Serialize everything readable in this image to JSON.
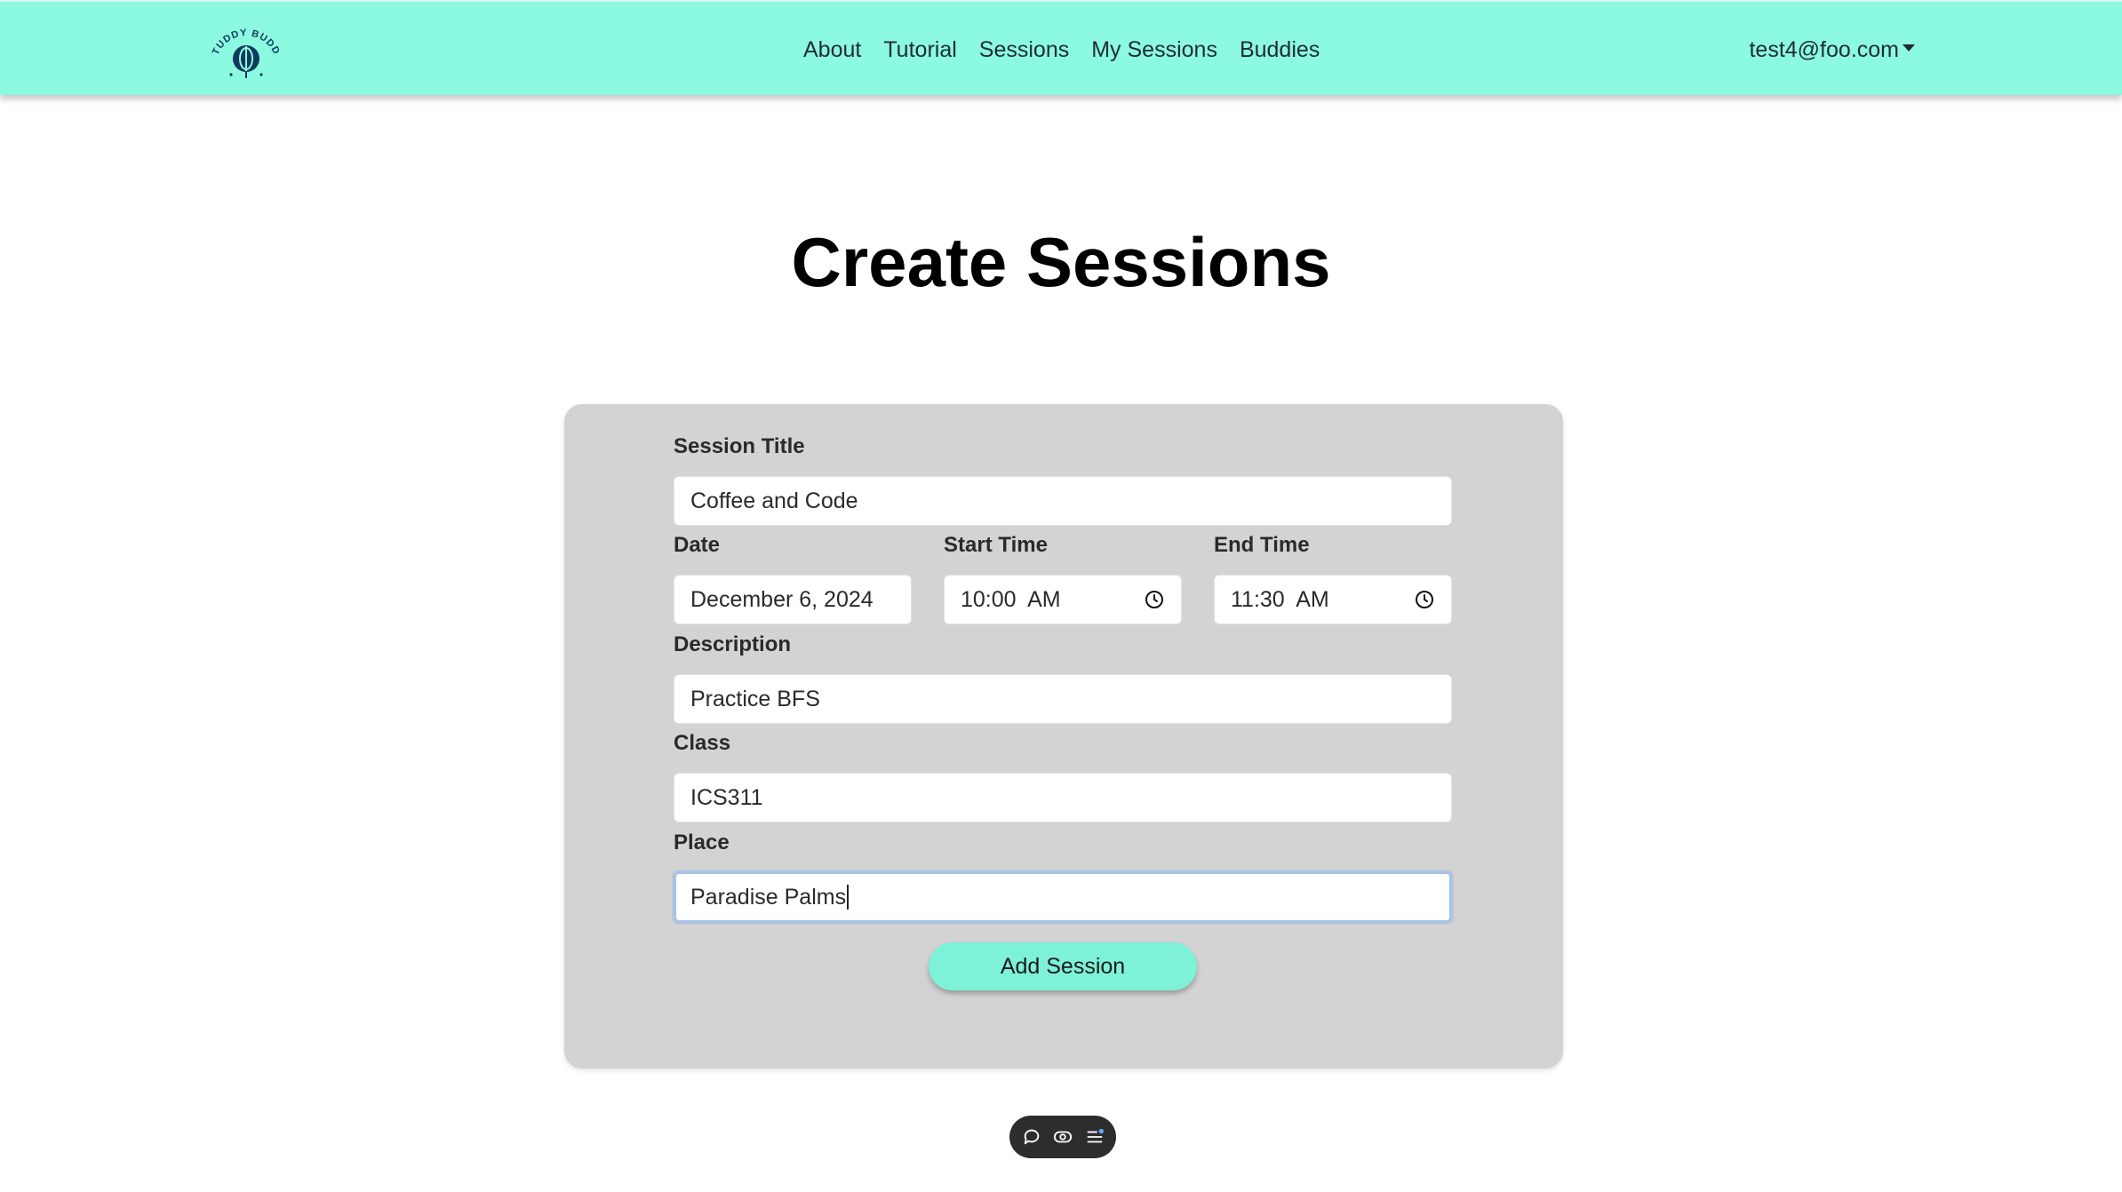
{
  "nav": {
    "logo_alt": "STUDDY BUDDY",
    "links": [
      "About",
      "Tutorial",
      "Sessions",
      "My Sessions",
      "Buddies"
    ],
    "user_email": "test4@foo.com"
  },
  "page": {
    "title": "Create Sessions"
  },
  "form": {
    "session_title": {
      "label": "Session Title",
      "value": "Coffee and Code"
    },
    "date": {
      "label": "Date",
      "value": "December 6, 2024"
    },
    "start_time": {
      "label": "Start Time",
      "value": "10:00  AM"
    },
    "end_time": {
      "label": "End Time",
      "value": "11:30  AM"
    },
    "description": {
      "label": "Description",
      "value": "Practice BFS"
    },
    "class": {
      "label": "Class",
      "value": "ICS311"
    },
    "place": {
      "label": "Place",
      "value": "Paradise Palms"
    },
    "submit_label": "Add Session"
  },
  "colors": {
    "navbar": "#8cf9e1",
    "accent_button": "#7df2d8",
    "card": "#d3d3d3"
  },
  "floating_toolbar": {
    "icons": [
      "comment-icon",
      "eye-icon",
      "menu-list-icon"
    ]
  }
}
